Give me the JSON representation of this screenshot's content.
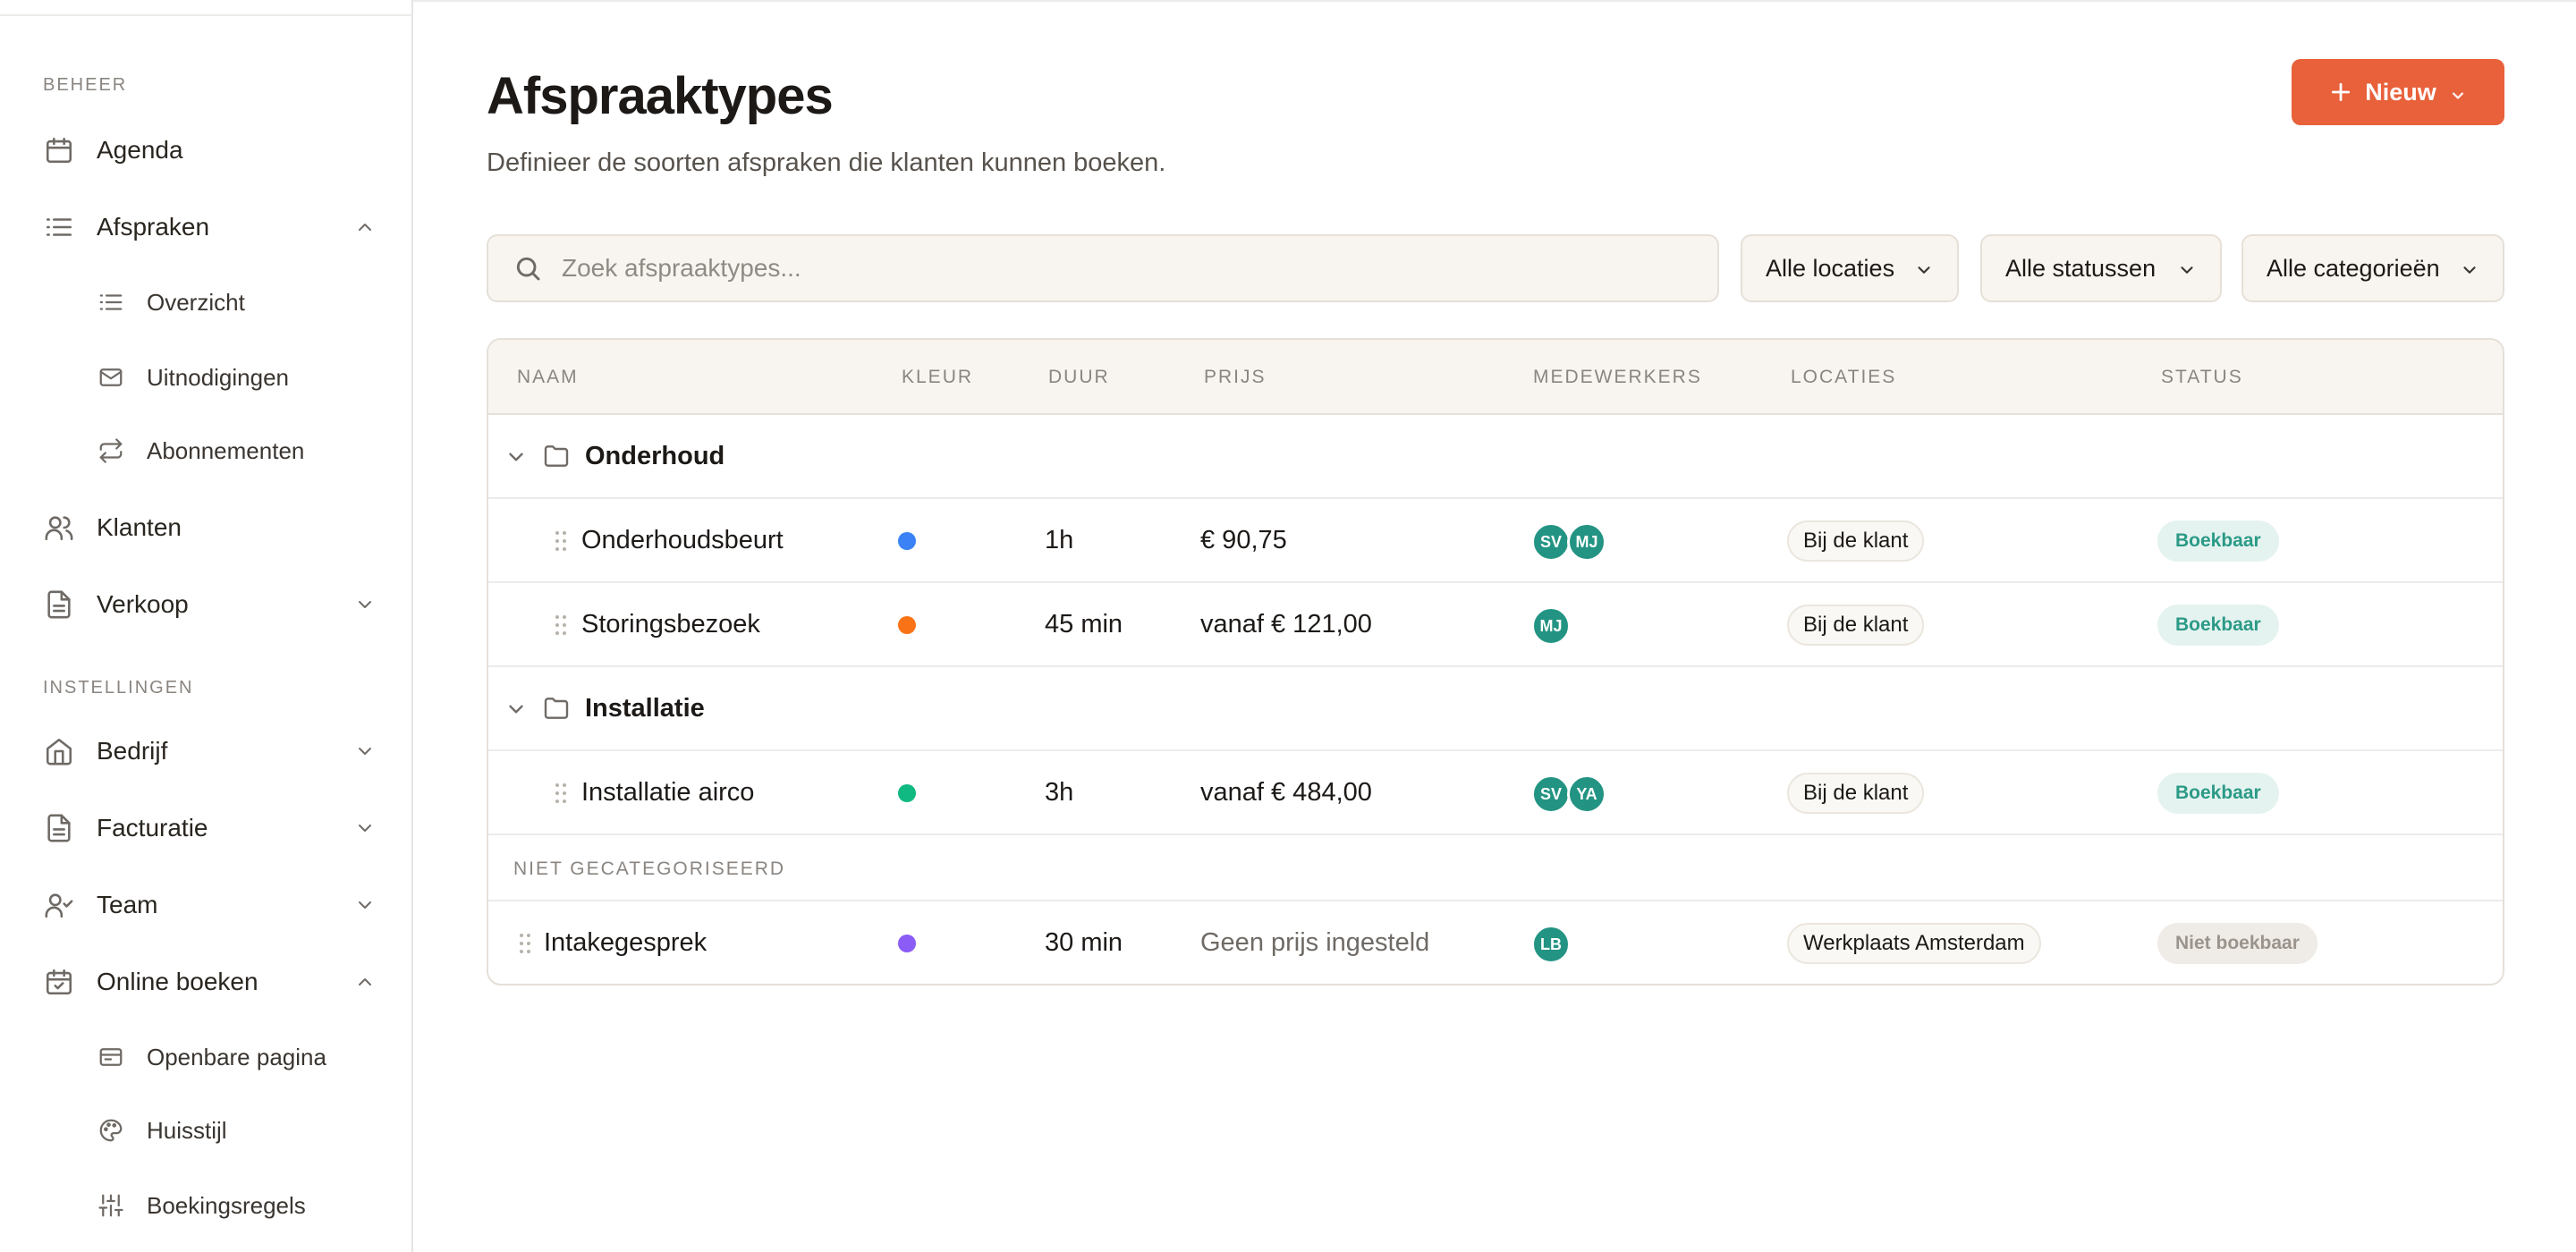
{
  "sidebar": {
    "sections": [
      {
        "label": "BEHEER"
      },
      {
        "label": "INSTELLINGEN"
      }
    ],
    "items": {
      "agenda": "Agenda",
      "afspraken": "Afspraken",
      "overzicht": "Overzicht",
      "uitnodigingen": "Uitnodigingen",
      "abonnementen": "Abonnementen",
      "klanten": "Klanten",
      "verkoop": "Verkoop",
      "bedrijf": "Bedrijf",
      "facturatie": "Facturatie",
      "team": "Team",
      "online_boeken": "Online boeken",
      "openbare_pagina": "Openbare pagina",
      "huisstijl": "Huisstijl",
      "boekingsregels": "Boekingsregels"
    }
  },
  "header": {
    "title": "Afspraaktypes",
    "subtitle": "Definieer de soorten afspraken die klanten kunnen boeken.",
    "new_button": "Nieuw"
  },
  "search": {
    "placeholder": "Zoek afspraaktypes...",
    "value": ""
  },
  "filters": {
    "locations": "Alle locaties",
    "statuses": "Alle statussen",
    "categories": "Alle categorieën"
  },
  "table": {
    "columns": {
      "name": "NAAM",
      "color": "KLEUR",
      "duration": "DUUR",
      "price": "PRIJS",
      "staff": "MEDEWERKERS",
      "locations": "LOCATIES",
      "status": "STATUS"
    },
    "groups": [
      {
        "name": "Onderhoud",
        "rows": [
          {
            "name": "Onderhoudsbeurt",
            "color": "#3b82f6",
            "duration": "1h",
            "price": "€ 90,75",
            "staff": [
              "SV",
              "MJ"
            ],
            "location": "Bij de klant",
            "status": "Boekbaar"
          },
          {
            "name": "Storingsbezoek",
            "color": "#f97316",
            "duration": "45 min",
            "price": "vanaf € 121,00",
            "staff": [
              "MJ"
            ],
            "location": "Bij de klant",
            "status": "Boekbaar"
          }
        ]
      },
      {
        "name": "Installatie",
        "rows": [
          {
            "name": "Installatie airco",
            "color": "#10b981",
            "duration": "3h",
            "price": "vanaf € 484,00",
            "staff": [
              "SV",
              "YA"
            ],
            "location": "Bij de klant",
            "status": "Boekbaar"
          }
        ]
      }
    ],
    "uncategorized_label": "NIET GECATEGORISEERD",
    "uncategorized": [
      {
        "name": "Intakegesprek",
        "color": "#8b5cf6",
        "duration": "30 min",
        "price": "Geen prijs ingesteld",
        "staff": [
          "LB"
        ],
        "location": "Werkplaats Amsterdam",
        "status": "Niet boekbaar"
      }
    ]
  },
  "colors": {
    "accent": "#e8613a",
    "avatar": "#239483",
    "status_ok_bg": "#e5f3f0",
    "status_ok_text": "#2b9a86",
    "status_no_bg": "#efebe6",
    "status_no_text": "#9a948d"
  }
}
